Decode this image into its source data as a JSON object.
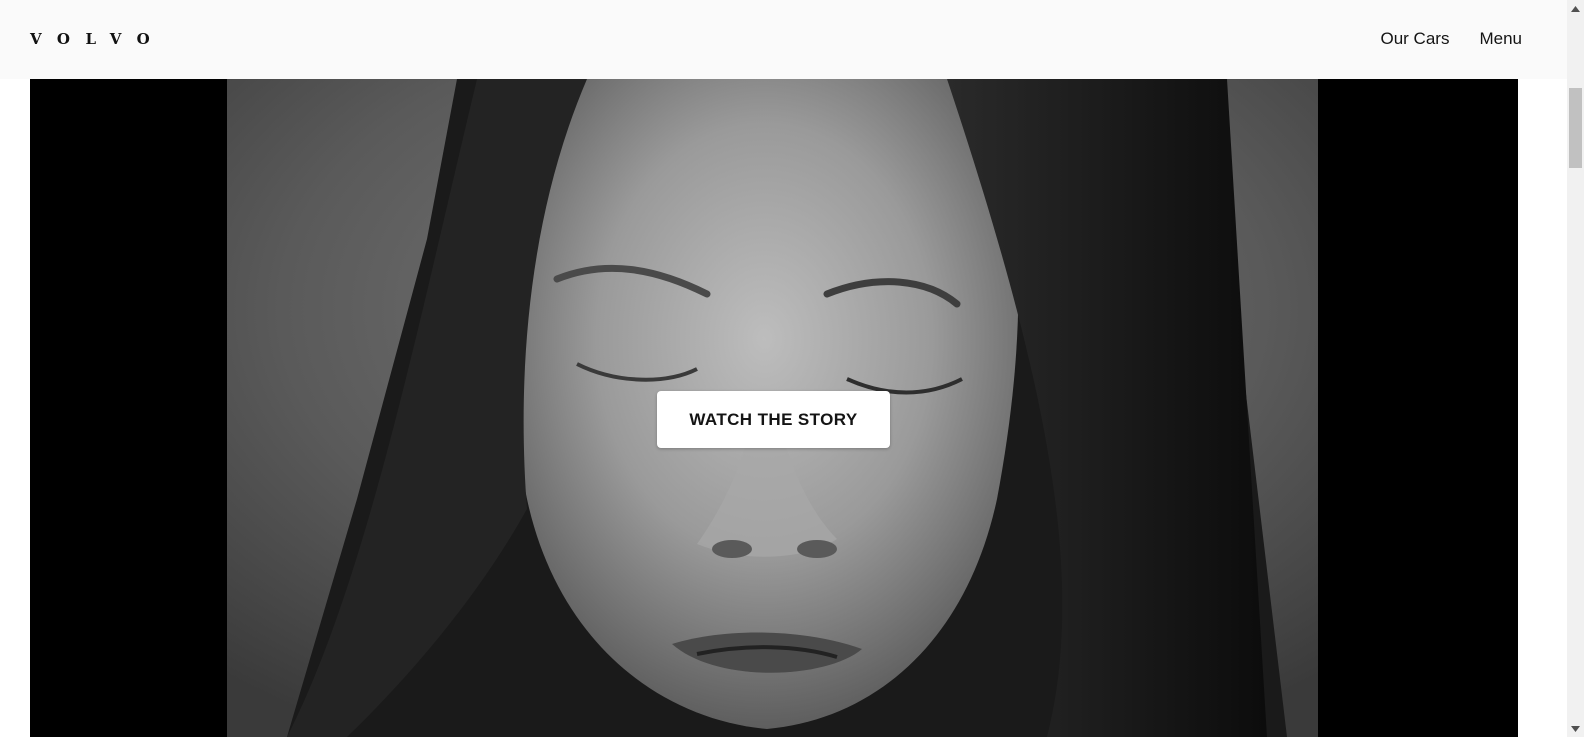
{
  "header": {
    "logo_text": "VOLVO",
    "nav": [
      {
        "label": "Our Cars"
      },
      {
        "label": "Menu"
      }
    ]
  },
  "hero": {
    "image_description_icon": "portrait-photo",
    "cta_label": "WATCH THE STORY"
  },
  "colors": {
    "header_bg": "#fafafa",
    "hero_bg": "#000000",
    "button_bg": "#ffffff",
    "text": "#141414"
  }
}
